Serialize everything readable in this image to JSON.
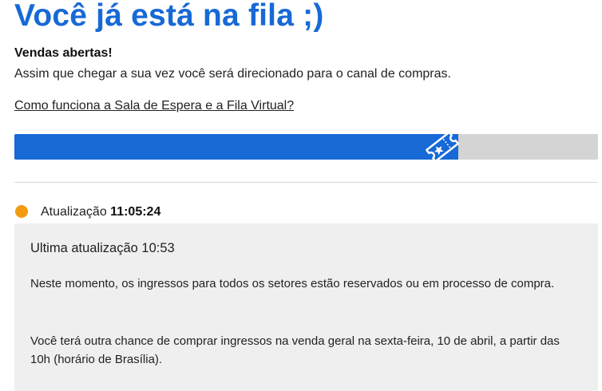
{
  "page": {
    "title": "Você já está na fila ;)",
    "subhead": "Vendas abertas!",
    "description": "Assim que chegar a sua vez você será direcionado para o canal de compras.",
    "help_link": "Como funciona a Sala de Espera e a Fila Virtual?"
  },
  "queue": {
    "progress": 0.76,
    "icon": "ticket-icon",
    "fill_color": "#1769d6",
    "track_color": "#d4d4d4"
  },
  "status": {
    "dot_color": "#f39c12",
    "label": "Atualização",
    "time": "11:05:24"
  },
  "info": {
    "last_update": "Ultima atualização 10:53",
    "paragraph_1": "Neste momento, os ingressos para todos os setores estão reservados ou em processo de compra.",
    "paragraph_2": "Você terá outra chance de comprar ingressos na venda geral na sexta-feira, 10 de abril, a partir das 10h (horário de Brasília)."
  }
}
